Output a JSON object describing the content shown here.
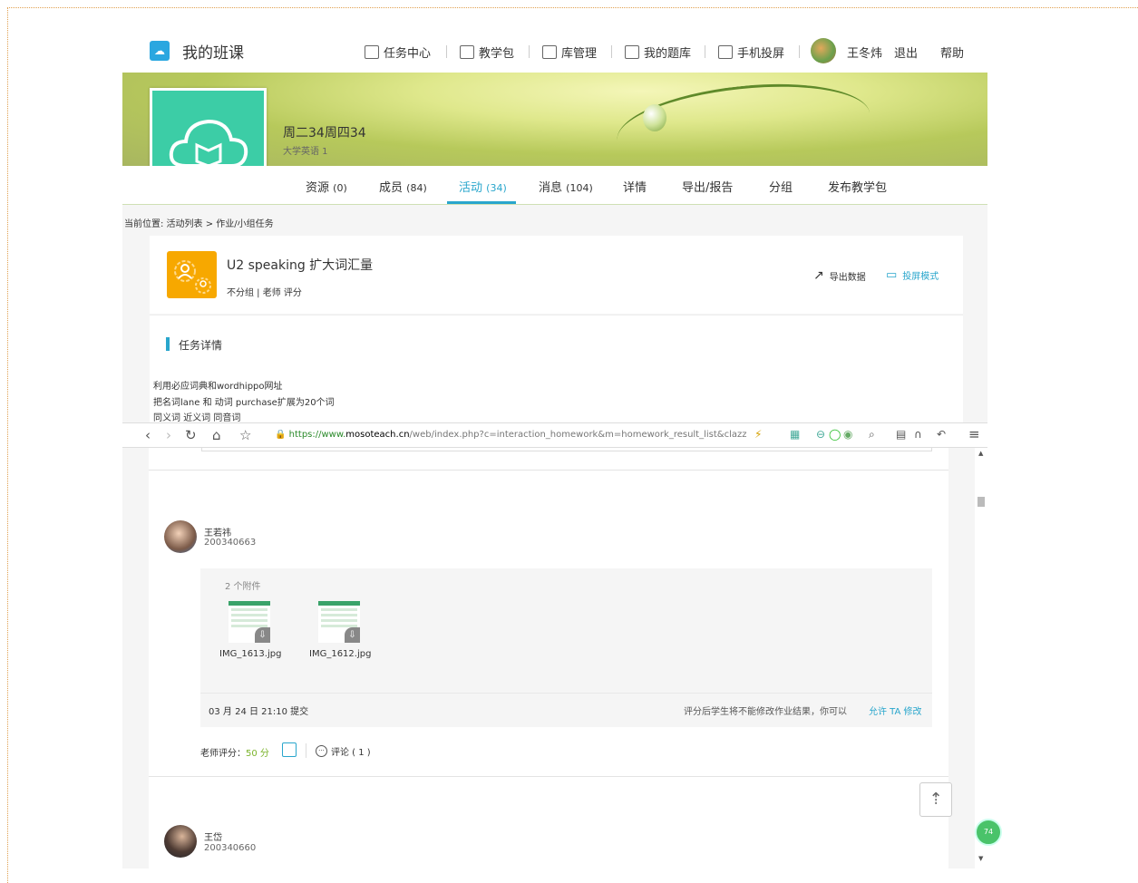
{
  "header": {
    "brand": "我的班课",
    "nav": [
      {
        "label": "任务中心",
        "icon": "clipboard-icon"
      },
      {
        "label": "教学包",
        "icon": "package-icon"
      },
      {
        "label": "库管理",
        "icon": "archive-icon"
      },
      {
        "label": "我的题库",
        "icon": "layers-icon"
      },
      {
        "label": "手机投屏",
        "icon": "screen-cast-icon"
      }
    ],
    "user_name": "王冬炜",
    "logout": "退出",
    "help": "帮助"
  },
  "class": {
    "title": "周二34周四34",
    "subtitle": "大学英语 1"
  },
  "tabs": [
    {
      "label": "资源",
      "count": "(0)"
    },
    {
      "label": "成员",
      "count": "(84)"
    },
    {
      "label": "活动",
      "count": "(34)"
    },
    {
      "label": "消息",
      "count": "(104)"
    },
    {
      "label": "详情",
      "count": ""
    },
    {
      "label": "导出/报告",
      "count": ""
    },
    {
      "label": "分组",
      "count": ""
    },
    {
      "label": "发布教学包",
      "count": ""
    }
  ],
  "breadcrumb": "当前位置: 活动列表 > 作业/小组任务",
  "task": {
    "title": "U2 speaking 扩大词汇量",
    "meta": "不分组 | 老师 评分",
    "export_label": "导出数据",
    "screen_mode_label": "投屏模式"
  },
  "details": {
    "heading": "任务详情",
    "lines": [
      "利用必应词典和wordhippo网址",
      "把名词lane 和 动词 purchase扩展为20个词",
      "同义词 近义词 同音词"
    ]
  },
  "browser": {
    "url_scheme": "https://www.",
    "url_domain": "mosoteach.cn",
    "url_path": "/web/index.php?c=interaction_homework&m=homework_result_list&clazz"
  },
  "students": [
    {
      "name": "王若祎",
      "id": "200340663",
      "attachment_count": "2 个附件",
      "files": [
        "IMG_1613.jpg",
        "IMG_1612.jpg"
      ],
      "submitted": "03 月 24 日 21:10 提交",
      "note": "评分后学生将不能修改作业结果，你可以",
      "allow_label": "允许 TA 修改",
      "score_label": "老师评分：",
      "score_value": "50 分",
      "comment_label": "评论 ( 1 )"
    },
    {
      "name": "王岱",
      "id": "200340660"
    }
  ],
  "badge": "74"
}
